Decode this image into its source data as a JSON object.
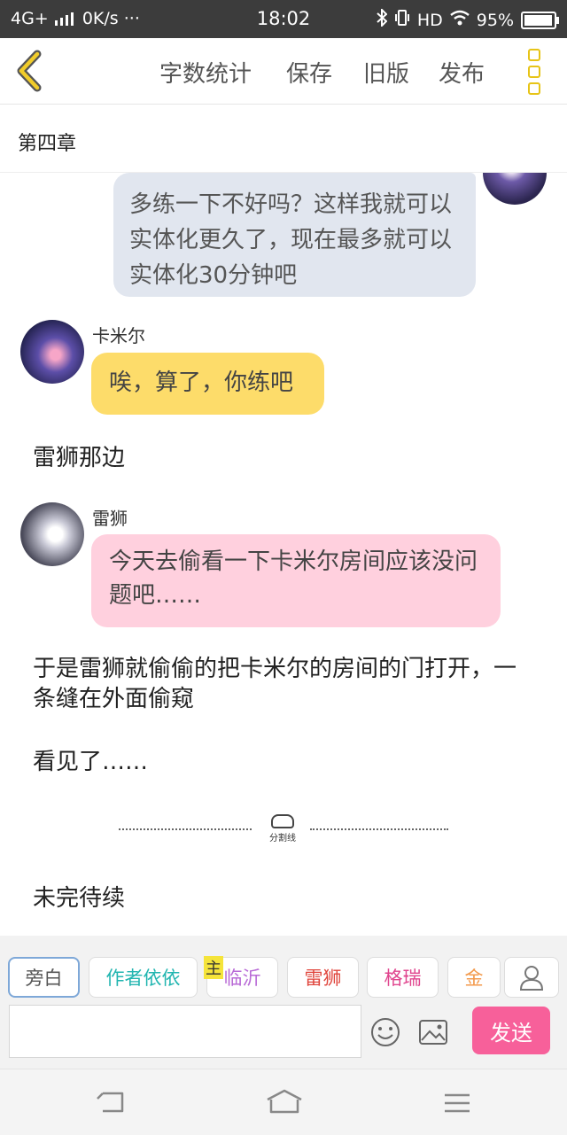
{
  "status_bar": {
    "network": "4G+",
    "speed": "0K/s",
    "dots": "···",
    "time": "18:02",
    "hd": "HD",
    "battery": "95%",
    "battery_level": 0.95
  },
  "toolbar": {
    "word_count": "字数统计",
    "save": "保存",
    "old_version": "旧版",
    "publish": "发布"
  },
  "chapter": {
    "title": "第四章"
  },
  "messages": {
    "m1": {
      "text": "多练一下不好吗？这样我就可以实体化更久了，现在最多就可以实体化30分钟吧"
    },
    "m2": {
      "name": "卡米尔",
      "text": "唉，算了，你练吧"
    },
    "n1": "雷狮那边",
    "m3": {
      "name": "雷狮",
      "text": "今天去偷看一下卡米尔房间应该没问题吧……"
    },
    "n2": "于是雷狮就偷偷的把卡米尔的房间的门打开，一条缝在外面偷窥",
    "n3": "看见了……",
    "divider": "分割线",
    "n4": "未完待续"
  },
  "roles": {
    "narration": "旁白",
    "author": "作者依依",
    "main_badge": "主",
    "linyi": "临沂",
    "leishi": "雷狮",
    "gerui": "格瑞",
    "jin": "金"
  },
  "composer": {
    "placeholder": "",
    "send": "发送"
  },
  "colors": {
    "accent_yellow": "#e7c417",
    "send_pink": "#f7609a",
    "bubble_yellow": "#fddc6a",
    "bubble_pink": "#ffd0de",
    "bubble_gray": "#e1e6ef"
  }
}
